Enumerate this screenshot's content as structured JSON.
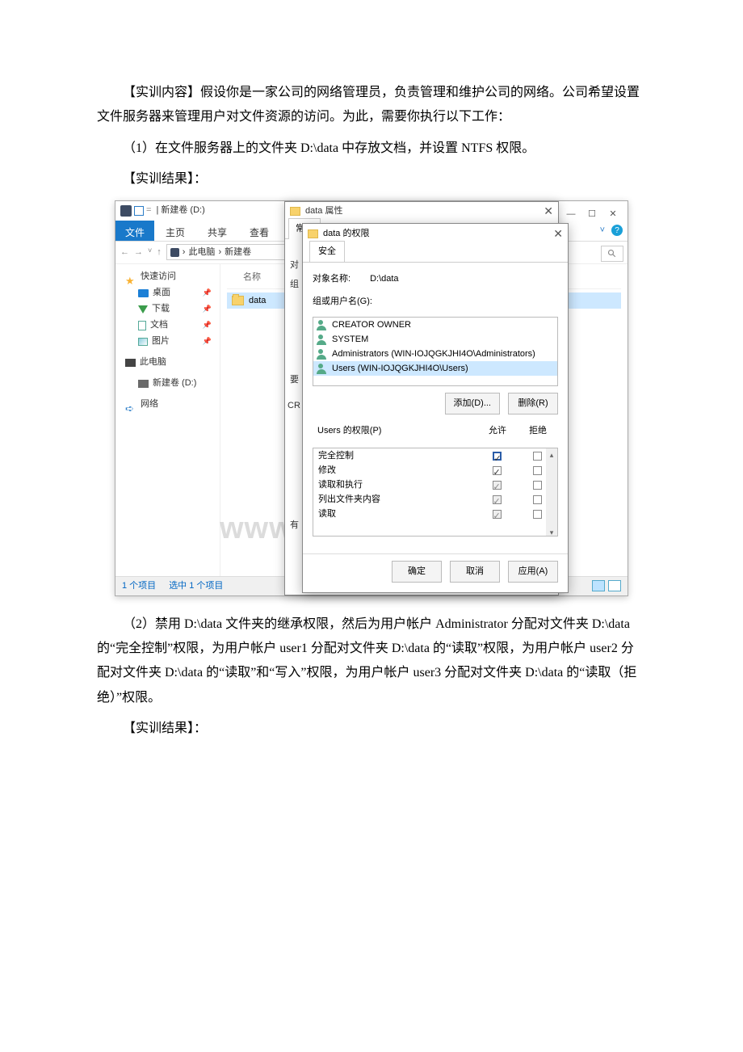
{
  "doc": {
    "p1": "【实训内容】假设你是一家公司的网络管理员，负责管理和维护公司的网络。公司希望设置文件服务器来管理用户对文件资源的访问。为此，需要你执行以下工作：",
    "p2": "（1）在文件服务器上的文件夹 D:\\data 中存放文档，并设置 NTFS 权限。",
    "p3": "【实训结果】：",
    "p4": "（2）禁用 D:\\data 文件夹的继承权限，然后为用户帐户 Administrator 分配对文件夹 D:\\data 的“完全控制”权限，为用户帐户 user1 分配对文件夹 D:\\data 的“读取”权限，为用户帐户 user2 分配对文件夹 D:\\data 的“读取”和“写入”权限，为用户帐户 user3 分配对文件夹 D:\\data 的“读取（拒绝）”权限。",
    "p5": "【实训结果】："
  },
  "explorer": {
    "title": "新建卷 (D:)",
    "tabs": {
      "file": "文件",
      "home": "主页",
      "share": "共享",
      "view": "查看"
    },
    "bc_pc": "此电脑",
    "bc_drive": "新建卷",
    "colName": "名称",
    "folder": "data",
    "nav": {
      "quick": "快速访问",
      "desktop": "桌面",
      "downloads": "下载",
      "docs": "文档",
      "pics": "图片",
      "pc": "此电脑",
      "drive": "新建卷 (D:)",
      "network": "网络"
    },
    "status_count": "1 个项目",
    "status_sel": "选中 1 个项目"
  },
  "props": {
    "title": "data 属性",
    "tab_general": "常规",
    "side_dui": "对",
    "side_zu": "组",
    "side_yao": "要",
    "side_cr": "CR",
    "side_you": "有"
  },
  "perm": {
    "title": "data 的权限",
    "tab_security": "安全",
    "objname_label": "对象名称:",
    "objname_value": "D:\\data",
    "groups_label": "组或用户名(G):",
    "users": [
      "CREATOR OWNER",
      "SYSTEM",
      "Administrators (WIN-IOJQGKJHI4O\\Administrators)",
      "Users (WIN-IOJQGKJHI4O\\Users)"
    ],
    "add_btn": "添加(D)...",
    "remove_btn": "删除(R)",
    "perms_label": "Users 的权限(P)",
    "col_allow": "允许",
    "col_deny": "拒绝",
    "rows": [
      {
        "name": "完全控制",
        "allow": true,
        "allowStrong": true,
        "deny": false
      },
      {
        "name": "修改",
        "allow": true,
        "deny": false
      },
      {
        "name": "读取和执行",
        "allow": true,
        "gray": true,
        "deny": false
      },
      {
        "name": "列出文件夹内容",
        "allow": true,
        "gray": true,
        "deny": false
      },
      {
        "name": "读取",
        "allow": true,
        "gray": true,
        "deny": false
      }
    ],
    "ok": "确定",
    "cancel": "取消",
    "apply": "应用(A)"
  },
  "watermark": "www.bdocx.com"
}
